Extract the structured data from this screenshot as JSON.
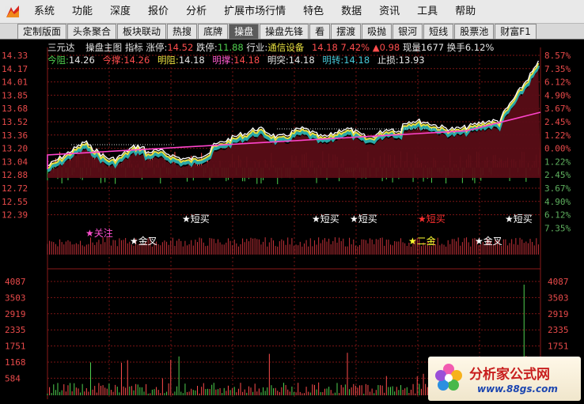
{
  "menu": [
    "系统",
    "功能",
    "深度",
    "报价",
    "分析",
    "扩展市场行情",
    "特色",
    "数据",
    "资讯",
    "工具",
    "帮助"
  ],
  "tabs": [
    {
      "label": "定制版面",
      "active": false
    },
    {
      "label": "头条聚合",
      "active": false
    },
    {
      "label": "板块联动",
      "active": false
    },
    {
      "label": "热搜",
      "active": false
    },
    {
      "label": "底牌",
      "active": false
    },
    {
      "label": "操盘",
      "active": true
    },
    {
      "label": "操盘先锋",
      "active": false
    },
    {
      "label": "看",
      "active": false
    },
    {
      "label": "摆渡",
      "active": false
    },
    {
      "label": "吸抛",
      "active": false
    },
    {
      "label": "银河",
      "active": false
    },
    {
      "label": "短线",
      "active": false
    },
    {
      "label": "股票池",
      "active": false
    },
    {
      "label": "财富F1",
      "active": false
    }
  ],
  "info": {
    "stock_name": "三元达",
    "indicator_label": "操盘主图",
    "indicator_word": "指标",
    "limit_up_label": "涨停:",
    "limit_up": "14.52",
    "limit_down_label": "跌停:",
    "limit_down": "11.88",
    "industry_label": "行业:",
    "industry": "通信设备",
    "price": "14.18",
    "change_pct": "7.42%",
    "change_arrow": "▲",
    "change": "0.98",
    "volume_label": "现量",
    "volume": "1677",
    "turnover_label": "换手",
    "turnover": "6.12%",
    "today_resist_label": "今阻:",
    "today_resist": "14.26",
    "today_support_label": "今撑:",
    "today_support": "14.26",
    "tomorrow_resist_label": "明阻:",
    "tomorrow_resist": "14.18",
    "tomorrow_support_label": "明撑:",
    "tomorrow_support": "14.18",
    "tomorrow_break_label": "明突:",
    "tomorrow_break": "14.18",
    "tomorrow_turn_label": "明转:",
    "tomorrow_turn": "14.18",
    "stop_loss_label": "止损:",
    "stop_loss": "13.93"
  },
  "axis_left_price": [
    "14.33",
    "14.17",
    "14.01",
    "13.85",
    "13.68",
    "13.52",
    "13.36",
    "13.20",
    "13.04",
    "12.88",
    "12.72",
    "12.55",
    "12.39"
  ],
  "axis_right_pct": [
    "8.57%",
    "7.35%",
    "6.12%",
    "4.90%",
    "3.67%",
    "2.45%",
    "1.22%",
    "0.00%",
    "1.22%",
    "2.45%",
    "3.67%",
    "4.90%",
    "6.12%",
    "7.35%"
  ],
  "axis_left_volume": [
    "4087",
    "3503",
    "2919",
    "2335",
    "1751",
    "1168",
    "584"
  ],
  "axis_right_volume": [
    "4087",
    "3503",
    "2919",
    "2335",
    "1751",
    "1168"
  ],
  "signals": [
    {
      "label": "★关注",
      "color": "#ff4fd0"
    },
    {
      "label": "★金叉",
      "color": "#ffffff"
    },
    {
      "label": "★短买",
      "color": "#ffffff"
    },
    {
      "label": "★短买",
      "color": "#ffffff"
    },
    {
      "label": "★短买",
      "color": "#ffffff"
    },
    {
      "label": "★短买",
      "color": "#ff3030"
    },
    {
      "label": "★二金",
      "color": "#ffff30"
    },
    {
      "label": "★金叉",
      "color": "#ffffff"
    },
    {
      "label": "★短买",
      "color": "#ffffff"
    }
  ],
  "colors": {
    "up": "#ff4d4d",
    "down": "#4fd04f",
    "price_line": "#ffffff",
    "avg_line": "#ff44cc",
    "grid": "#7a1515",
    "background": "#000000"
  },
  "watermark": {
    "title": "分析家公式网",
    "url": "www.88gs.com"
  }
}
